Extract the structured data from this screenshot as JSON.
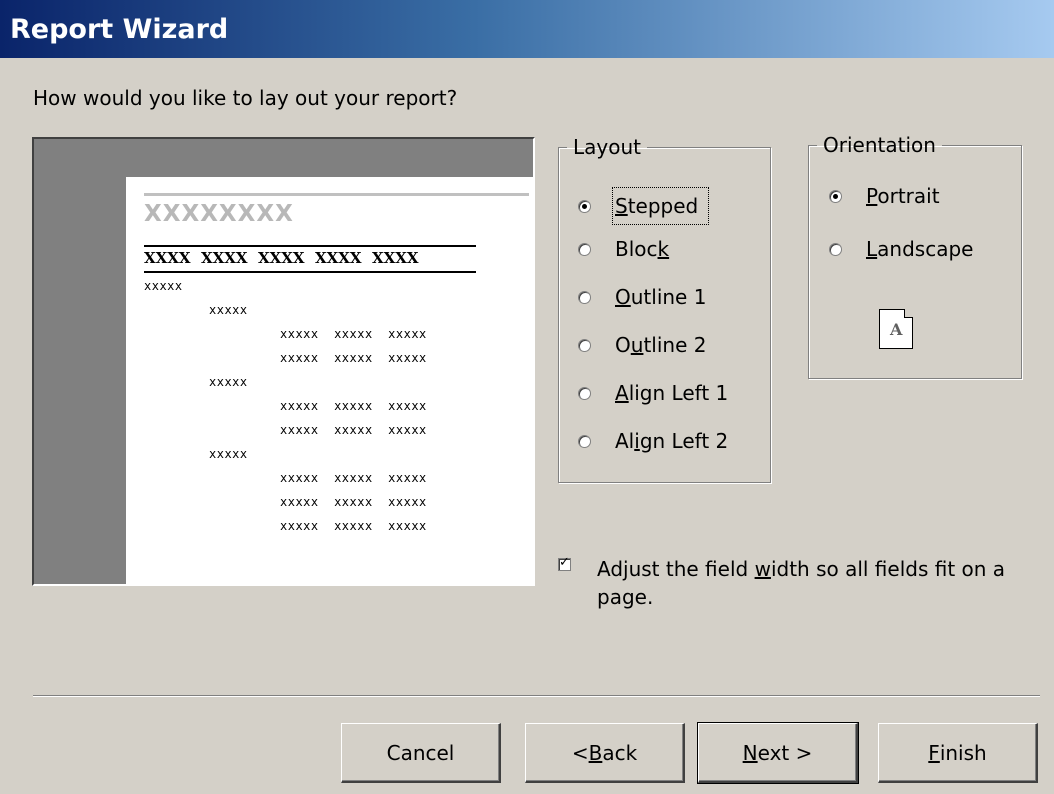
{
  "window": {
    "title": "Report Wizard"
  },
  "question": "How would you like to lay out your report?",
  "preview": {
    "title": "XXXXXXXX",
    "header": "XXXX  XXXX  XXXX  XXXX  XXXX",
    "rows": [
      {
        "text": "xxxxx",
        "level": 0
      },
      {
        "text": "xxxxx",
        "level": 1
      },
      {
        "text": "xxxxx  xxxxx  xxxxx",
        "level": 2
      },
      {
        "text": "xxxxx  xxxxx  xxxxx",
        "level": 2
      },
      {
        "text": "xxxxx",
        "level": 1
      },
      {
        "text": "xxxxx  xxxxx  xxxxx",
        "level": 2
      },
      {
        "text": "xxxxx  xxxxx  xxxxx",
        "level": 2
      },
      {
        "text": "xxxxx",
        "level": 1
      },
      {
        "text": "xxxxx  xxxxx  xxxxx",
        "level": 2
      },
      {
        "text": "xxxxx  xxxxx  xxxxx",
        "level": 2
      },
      {
        "text": "xxxxx  xxxxx  xxxxx",
        "level": 2
      }
    ]
  },
  "layout": {
    "legend": "Layout",
    "options": [
      {
        "pre": "",
        "key": "S",
        "post": "tepped",
        "selected": true
      },
      {
        "pre": "Bloc",
        "key": "k",
        "post": "",
        "selected": false
      },
      {
        "pre": "",
        "key": "O",
        "post": "utline 1",
        "selected": false
      },
      {
        "pre": "O",
        "key": "u",
        "post": "tline 2",
        "selected": false
      },
      {
        "pre": "",
        "key": "A",
        "post": "lign Left 1",
        "selected": false
      },
      {
        "pre": "Al",
        "key": "i",
        "post": "gn Left 2",
        "selected": false
      }
    ]
  },
  "orientation": {
    "legend": "Orientation",
    "options": [
      {
        "pre": "",
        "key": "P",
        "post": "ortrait",
        "selected": true
      },
      {
        "pre": "",
        "key": "L",
        "post": "andscape",
        "selected": false
      }
    ],
    "icon_letter": "A"
  },
  "adjust": {
    "checked": true,
    "pre": "Adjust the field ",
    "key": "w",
    "post": "idth so all fields fit on a page."
  },
  "buttons": {
    "cancel": {
      "pre": "Cancel",
      "key": "",
      "post": ""
    },
    "back": {
      "pre": "< ",
      "key": "B",
      "post": "ack"
    },
    "next": {
      "pre": "",
      "key": "N",
      "post": "ext >"
    },
    "finish": {
      "pre": "",
      "key": "F",
      "post": "inish"
    }
  }
}
